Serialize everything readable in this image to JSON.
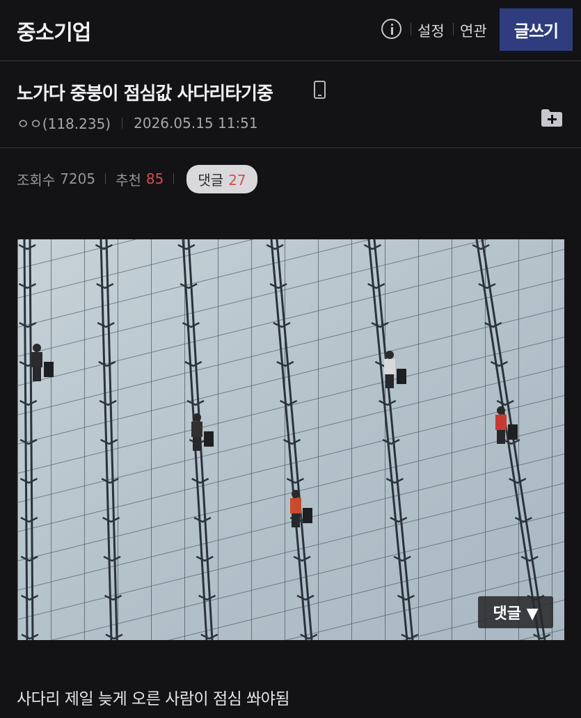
{
  "header": {
    "board_title": "중소기업",
    "settings_label": "설정",
    "related_label": "연관",
    "write_label": "글쓰기"
  },
  "post": {
    "title": "노가다 중붕이 점심값 사다리타기중",
    "author": "ㅇㅇ(118.235)",
    "datetime": "2026.05.15 11:51",
    "views_label": "조회수",
    "views": "7205",
    "recommend_label": "추천",
    "recommend": "85",
    "comments_label": "댓글",
    "comments": "27",
    "body": "사다리 제일 늦게 오른 사람이 점심 쏴야됨"
  },
  "image_overlay": {
    "comment_button": "댓글 ▼"
  },
  "icons": {
    "info": "info-icon",
    "mobile": "mobile-icon",
    "folder_add": "folder-add-icon"
  },
  "colors": {
    "background": "#131315",
    "write_button": "#2f3d7e",
    "accent_red": "#d84c4c"
  }
}
